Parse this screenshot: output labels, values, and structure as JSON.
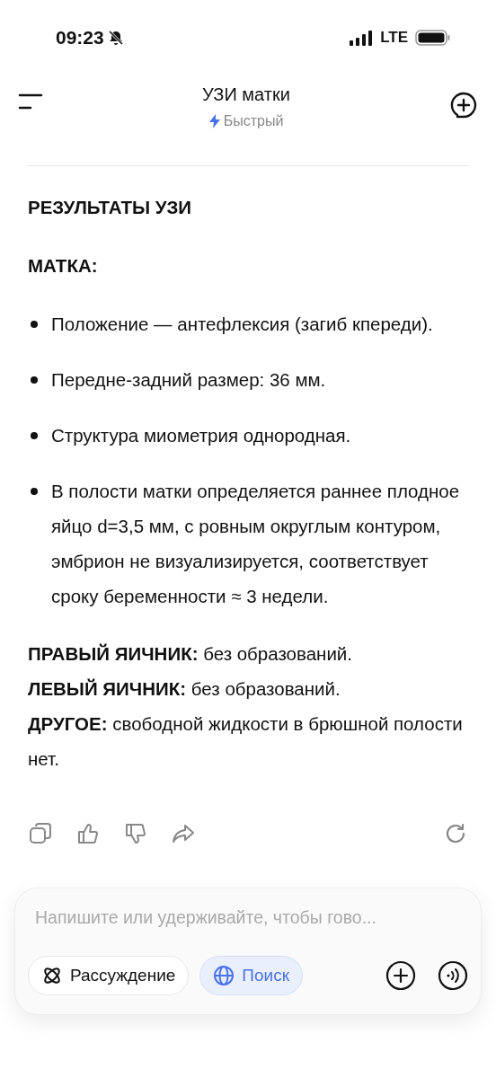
{
  "status_bar": {
    "time": "09:23",
    "network": "LTE"
  },
  "header": {
    "title": "УЗИ матки",
    "mode": "Быстрый"
  },
  "message": [
    {
      "kind": "heading",
      "text": "РЕЗУЛЬТАТЫ УЗИ"
    },
    {
      "kind": "heading",
      "text": "МАТКА:"
    },
    {
      "kind": "bullets",
      "items": [
        "Положение — антефлексия (загиб кпереди).",
        "Передне-задний размер: 36 мм.",
        "Структура миометрия однородная.",
        "В полости матки определяется раннее плодное яйцо d=3,5 мм, с ровным округлым контуром, эмбрион не визуализируется, соответствует сроку беременности ≈ 3 недели."
      ]
    },
    {
      "kind": "lines",
      "items": [
        "**ПРАВЫЙ ЯИЧНИК:** без образований.",
        "**ЛЕВЫЙ ЯИЧНИК:** без образований.",
        "**ДРУГОЕ:** свободной жидкости в брюшной полости нет."
      ]
    }
  ],
  "composer": {
    "placeholder": "Напишите или удерживайте, чтобы гово...",
    "toggles": [
      {
        "kind": "reasoning",
        "label": "Рассуждение",
        "selected": false
      },
      {
        "kind": "search",
        "label": "Поиск",
        "selected": true
      }
    ]
  }
}
